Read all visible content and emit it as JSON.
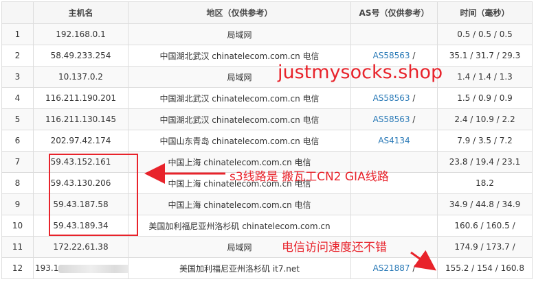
{
  "headers": {
    "index": "",
    "host": "主机名",
    "region": "地区（仅供参考）",
    "as": "AS号（仅供参考）",
    "time": "时间（毫秒）"
  },
  "rows": [
    {
      "idx": "1",
      "host": "192.168.0.1",
      "region": "局域网",
      "as": "",
      "as_sep": "",
      "time": "0.5 / 0.5 / 0.5"
    },
    {
      "idx": "2",
      "host": "58.49.233.254",
      "region": "中国湖北武汉 chinatelecom.com.cn 电信",
      "as": "AS58563",
      "as_sep": " /",
      "time": "35.1 / 31.7 / 29.3"
    },
    {
      "idx": "3",
      "host": "10.137.0.2",
      "region": "局域网",
      "as": "",
      "as_sep": "",
      "time": "1.4 / 1.4 / 1.3"
    },
    {
      "idx": "4",
      "host": "116.211.190.201",
      "region": "中国湖北武汉 chinatelecom.com.cn 电信",
      "as": "AS58563",
      "as_sep": " /",
      "time": "1.5 / 0.9 / 0.9"
    },
    {
      "idx": "5",
      "host": "116.211.130.145",
      "region": "中国湖北武汉 chinatelecom.com.cn 电信",
      "as": "AS58563",
      "as_sep": " /",
      "time": "2.4 / 10.9 / 2.2"
    },
    {
      "idx": "6",
      "host": "202.97.42.174",
      "region": "中国山东青岛 chinatelecom.com.cn 电信",
      "as": "AS4134",
      "as_sep": "",
      "time": "7.9 / 3.5 / 7.2"
    },
    {
      "idx": "7",
      "host": "59.43.152.161",
      "region": "中国上海 chinatelecom.com.cn 电信",
      "as": "",
      "as_sep": "",
      "time": "23.8 / 19.4 / 23.1"
    },
    {
      "idx": "8",
      "host": "59.43.130.206",
      "region": "中国上海 chinatelecom.com.cn 电信",
      "as": "",
      "as_sep": "",
      "time": "18.2"
    },
    {
      "idx": "9",
      "host": "59.43.187.58",
      "region": "中国上海 chinatelecom.com.cn 电信",
      "as": "",
      "as_sep": "",
      "time": "34.9 / 44.8 / 34.9"
    },
    {
      "idx": "10",
      "host": "59.43.189.34",
      "region": "美国加利福尼亚州洛杉矶 chinatelecom.com.cn",
      "as": "",
      "as_sep": "",
      "time": "160.6 / 160.5 /"
    },
    {
      "idx": "11",
      "host": "172.22.61.38",
      "region": "局域网",
      "as": "",
      "as_sep": "",
      "time": "174.9 / 173.7 /"
    },
    {
      "idx": "12",
      "host": "193.1",
      "region": "美国加利福尼亚州洛杉矶 it7.net",
      "as": "AS21887",
      "as_sep": " /",
      "time": "155.2 / 154 / 160.8"
    }
  ],
  "annotations": {
    "watermark": "justmysocks.shop",
    "s3_note": "s3线路是 搬瓦工CN2 GIA线路",
    "speed_note": "电信访问速度还不错"
  },
  "colors": {
    "annotation": "#e8232b",
    "as_link": "#2a7ab7"
  }
}
